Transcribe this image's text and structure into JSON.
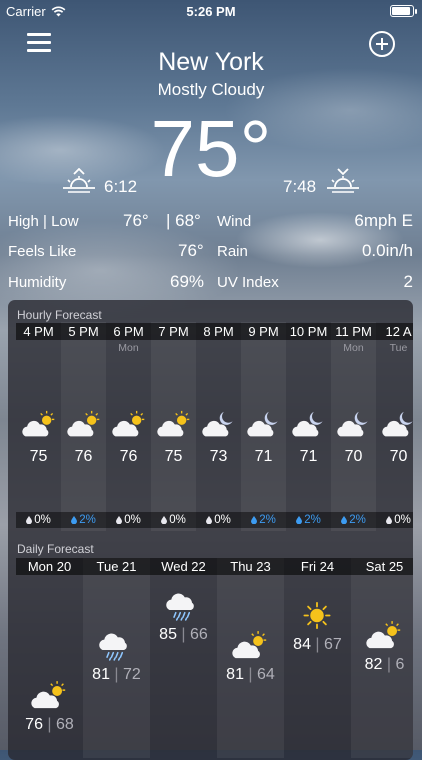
{
  "status_bar": {
    "carrier": "Carrier",
    "time": "5:26 PM"
  },
  "location": {
    "city": "New York",
    "condition": "Mostly Cloudy"
  },
  "current": {
    "temperature": "75°",
    "sunrise": "6:12",
    "sunset": "7:48"
  },
  "details": {
    "high_low_label": "High | Low",
    "high": "76°",
    "low": "| 68°",
    "wind_label": "Wind",
    "wind": "6mph E",
    "feels_like_label": "Feels Like",
    "feels_like": "76°",
    "rain_label": "Rain",
    "rain": "0.0in/h",
    "humidity_label": "Humidity",
    "humidity": "69%",
    "uv_label": "UV Index",
    "uv": "2"
  },
  "hourly": {
    "title": "Hourly Forecast",
    "hours": [
      {
        "time": "4 PM",
        "day": "",
        "temp": "75",
        "rain": "0%",
        "icon": "partly-cloudy-day-icon",
        "rain_active": false
      },
      {
        "time": "5 PM",
        "day": "",
        "temp": "76",
        "rain": "2%",
        "icon": "partly-cloudy-day-icon",
        "rain_active": true
      },
      {
        "time": "6 PM",
        "day": "Mon",
        "temp": "76",
        "rain": "0%",
        "icon": "partly-cloudy-day-icon",
        "rain_active": false
      },
      {
        "time": "7 PM",
        "day": "",
        "temp": "75",
        "rain": "0%",
        "icon": "partly-cloudy-day-icon",
        "rain_active": false
      },
      {
        "time": "8 PM",
        "day": "",
        "temp": "73",
        "rain": "0%",
        "icon": "partly-cloudy-night-icon",
        "rain_active": false
      },
      {
        "time": "9 PM",
        "day": "",
        "temp": "71",
        "rain": "2%",
        "icon": "partly-cloudy-night-icon",
        "rain_active": true
      },
      {
        "time": "10 PM",
        "day": "",
        "temp": "71",
        "rain": "2%",
        "icon": "partly-cloudy-night-icon",
        "rain_active": true
      },
      {
        "time": "11 PM",
        "day": "Mon",
        "temp": "70",
        "rain": "2%",
        "icon": "partly-cloudy-night-icon",
        "rain_active": true
      },
      {
        "time": "12 A",
        "day": "Tue",
        "temp": "70",
        "rain": "0%",
        "icon": "partly-cloudy-night-icon",
        "rain_active": false
      }
    ]
  },
  "daily": {
    "title": "Daily Forecast",
    "days": [
      {
        "day": "Mon 20",
        "high": "76",
        "low": "68",
        "icon": "partly-cloudy-day-icon"
      },
      {
        "day": "Tue 21",
        "high": "81",
        "low": "72",
        "icon": "rain-cloud-icon"
      },
      {
        "day": "Wed 22",
        "high": "85",
        "low": "66",
        "icon": "rain-cloud-icon"
      },
      {
        "day": "Thu 23",
        "high": "81",
        "low": "64",
        "icon": "partly-cloudy-day-icon"
      },
      {
        "day": "Fri 24",
        "high": "84",
        "low": "67",
        "icon": "sun-icon"
      },
      {
        "day": "Sat 25",
        "high": "82",
        "low": "6",
        "icon": "partly-cloudy-day-icon"
      }
    ]
  },
  "colors": {
    "rain_active": "#3d9cf2",
    "sun": "#f5c21b",
    "panel": "#28282f"
  }
}
